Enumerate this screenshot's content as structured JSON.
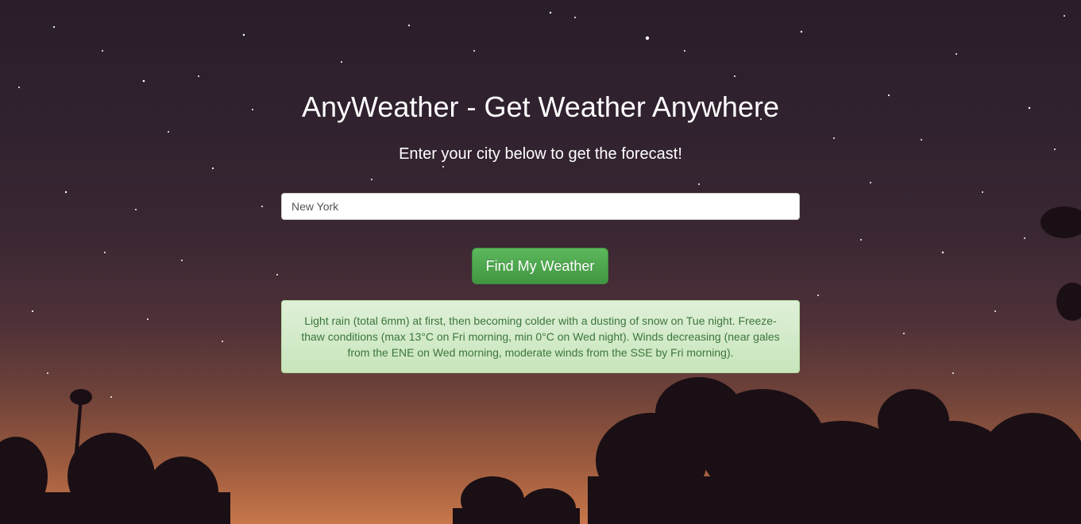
{
  "header": {
    "title": "AnyWeather - Get Weather Anywhere",
    "subtitle": "Enter your city below to get the forecast!"
  },
  "search": {
    "value": "New York",
    "button_label": "Find My Weather"
  },
  "forecast": {
    "text": "Light rain (total 6mm) at first, then becoming colder with a dusting of snow on Tue night. Freeze-thaw conditions (max 13°C on Fri morning, min 0°C on Wed night). Winds decreasing (near gales from the ENE on Wed morning, moderate winds from the SSE by Fri morning)."
  },
  "colors": {
    "button": "#5cb85c",
    "alert_background": "#dff0d8",
    "alert_text": "#3c763d"
  }
}
